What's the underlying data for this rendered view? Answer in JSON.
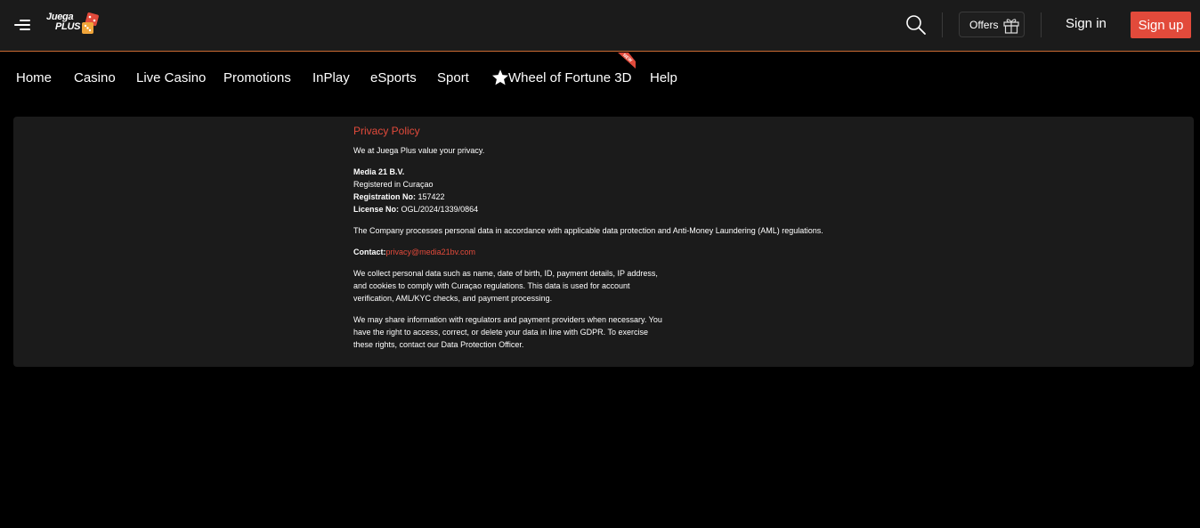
{
  "header": {
    "logo_line1": "Juega",
    "logo_line2": "PLUS",
    "offers_label": "Offers",
    "signin_label": "Sign in",
    "signup_label": "Sign up"
  },
  "nav": {
    "items": [
      "Home",
      "Casino",
      "Live Casino",
      "Promotions",
      "InPlay",
      "eSports",
      "Sport",
      "Wheel of Fortune 3D",
      "Help"
    ],
    "new_badge": "NEW"
  },
  "policy": {
    "title": "Privacy Policy",
    "intro": "We at Juega Plus value your privacy.",
    "company": "Media 21 B.V.",
    "registered": "Registered in Curaçao",
    "reg_label": "Registration No:",
    "reg_value": "157422",
    "license_label": "License No:",
    "license_value": "OGL/2024/1339/0864",
    "processing": "The Company processes personal data in accordance with applicable data protection and Anti-Money Laundering (AML) regulations.",
    "contact_label": "Contact:",
    "contact_email": "privacy@media21bv.com",
    "collect_lines": [
      "We collect personal data such as name, date of birth, ID, payment details, IP address,",
      "and cookies to comply with Curaçao regulations. This data is used for account",
      "verification, AML/KYC checks, and payment processing."
    ],
    "share_lines": [
      "We may share information with regulators and payment providers when necessary. You",
      "have the right to access, correct, or delete your data in line with GDPR. To exercise",
      "these rights, contact our Data Protection Officer."
    ]
  },
  "colors": {
    "accent": "#e24a3b",
    "topbar_bg": "#1b1b1b",
    "page_bg": "#000000",
    "header_border": "#c96a33"
  },
  "icons": [
    "menu-icon",
    "search-icon",
    "gift-icon",
    "star-icon",
    "dice-logo-icon"
  ]
}
